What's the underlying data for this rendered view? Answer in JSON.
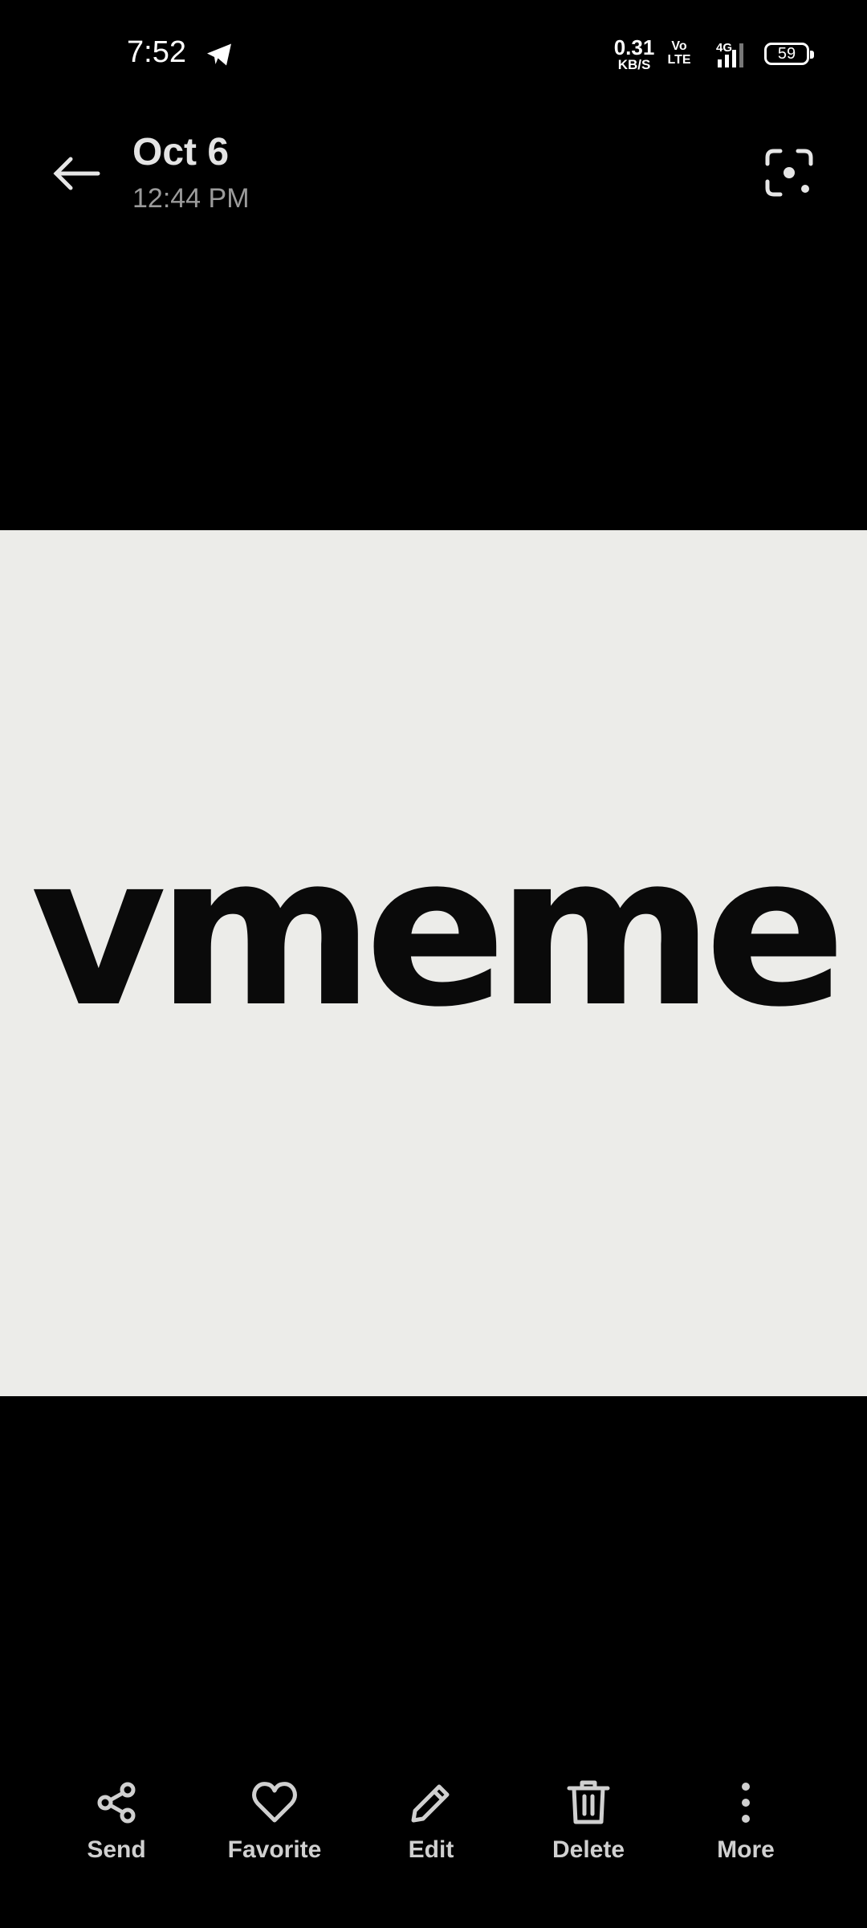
{
  "status_bar": {
    "time": "7:52",
    "net_speed_value": "0.31",
    "net_speed_unit": "KB/S",
    "volte": "Vo LTE",
    "network": "4G",
    "battery": "59"
  },
  "header": {
    "date": "Oct 6",
    "time": "12:44 PM"
  },
  "photo": {
    "text": "vmeme"
  },
  "toolbar": {
    "send": "Send",
    "favorite": "Favorite",
    "edit": "Edit",
    "delete": "Delete",
    "more": "More"
  },
  "icons": {
    "telegram": "telegram-icon",
    "back": "arrow-left-icon",
    "lens": "google-lens-icon",
    "send": "share-icon",
    "favorite": "heart-icon",
    "edit": "pencil-icon",
    "delete": "trash-icon",
    "more": "more-vertical-icon"
  }
}
